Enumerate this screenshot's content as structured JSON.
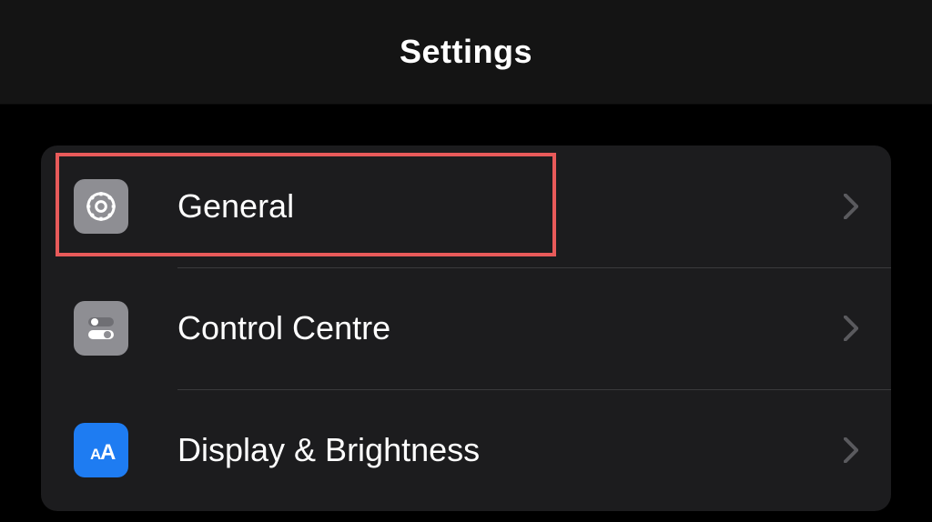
{
  "header": {
    "title": "Settings"
  },
  "rows": [
    {
      "label": "General",
      "icon": "gear-icon",
      "iconBg": "icon-gray",
      "highlighted": true
    },
    {
      "label": "Control Centre",
      "icon": "toggles-icon",
      "iconBg": "icon-gray",
      "highlighted": false
    },
    {
      "label": "Display & Brightness",
      "icon": "text-size-icon",
      "iconBg": "icon-blue",
      "highlighted": false
    }
  ]
}
